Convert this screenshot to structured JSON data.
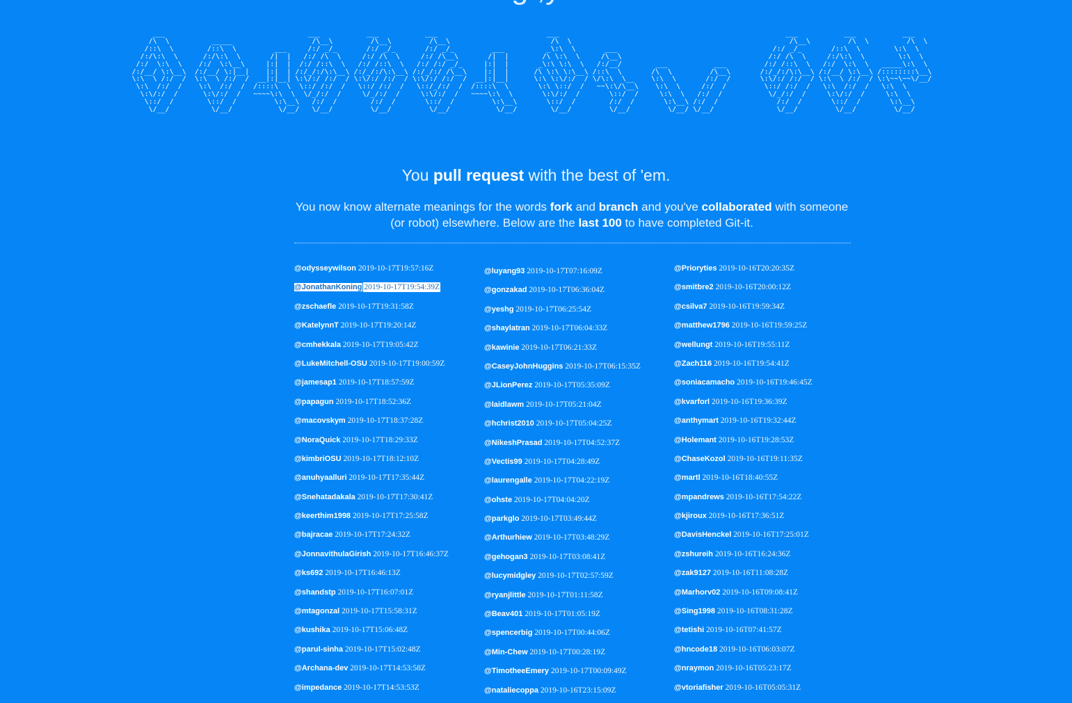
{
  "page": {
    "cut_heading": "g  ,y",
    "ascii_art": "      ___                                  ___           ___           ___                          ___                                                      ___           ___           ___     \n     /\\  \\          _____                   /\\__\\         /\\__\\         /\\__\\                        /\\  \\                                                    /\\__\\         /\\  \\         /\\  \\    \n    /::\\  \\        /::\\  \\         ___     /:/ _/_       /:/ _/_       /:/ _/_         ___          _\\:\\  \\       ___                                     /:/ _/_       /::\\  \\        \\:\\  \\   \n   /:/\\:\\  \\      /:/\\:\\  \\       /|  |   /:/ /\\  \\     /:/ /\\  \\     /:/ /\\__\\       /|  |        /\\ \\:\\  \\     /\\__\\                                   /:/ /\\  \\     /:/\\:\\  \\        \\:\\  \\  \n  /:/  \\:\\  \\    /:/  \\:\\__\\     |:|  |  /:/ /::\\  \\   /:/ /::\\  \\   /:/ /:/ _/_     |:|  |       _\\:\\ \\:\\  \\   /:/__/        ___           ___         /:/ /::\\  \\   /:/  \\:\\  \\   _____\\:\\  \\ \n /:/__/ \\:\\__\\  /:/__/ \\:|__|    |:|  | /:/_/:/\\:\\__\\ /:/_/:/\\:\\__\\ /:/_/:/ /\\__\\    |:|  |      /\\ \\:\\ \\:\\__\\ /::\\  \\       /\\  \\         /\\__\\       /:/_/:/\\:\\__\\ /:/__/ \\:\\__\\ /::::::::\\__\\\n \\:\\  \\ /:/  /  \\:\\  \\ /:/  /  __|:|__| \\:\\/:/ /:/  / \\:\\/:/ /:/  / \\:\\/:/ /:/  /  __|:|__|      \\:\\ \\:\\/:/  / \\/\\:\\  \\__    \\:\\  \\       /:/  /       \\:\\/:/ /:/  / \\:\\  \\ /:/  / \\:\\~~\\~~\\/__/\n  \\:\\  /:/  /    \\:\\  /:/  /  /::::\\  \\  \\::/ /:/  /   \\::/ /:/  /   \\::/_/:/  /  /::::\\  \\       \\:\\ \\::/  /   ~~\\:\\/\\__\\    \\:\\  \\     /:/  /         \\::/ /:/  /   \\:\\  /:/  /   \\:\\  \\      \n   \\:\\/:/  /      \\:\\/:/  /   ~~~~\\:\\  \\  \\/_/:/  /     \\/_/:/  /     \\:\\/:/  /   ~~~~\\:\\  \\       \\:\\/:/  /       \\::/  /     \\:\\  \\   /:/  /           \\/_/:/  /     \\:\\/:/  /     \\:\\  \\     \n    \\::/  /        \\::/  /         \\:\\__\\   /:/  /        /:/  /       \\::/  /         \\:\\__\\       \\::/  /        /:/  /       \\:\\__\\ /:/  /              /:/  /       \\::/  /       \\:\\__\\    \n     \\/__/          \\/__/           \\/__/   \\/__/         \\/__/         \\/__/           \\/__/        \\/__/         \\/__/         \\/__/ \\/__/               \\/__/         \\/__/         \\/__/    ",
    "tagline": {
      "pre": "You ",
      "bold": "pull request",
      "post": " with the best of 'em."
    },
    "intro": {
      "p1": "You now know alternate meanings for the words ",
      "b1": "fork",
      "p2": " and ",
      "b2": "branch",
      "p3": " and you've ",
      "b3": "collaborated",
      "p4": " with someone (or robot) elsewhere. Below are the ",
      "b4": "last 100",
      "p5": " to have completed Git-it."
    }
  },
  "completions": {
    "column1": [
      {
        "user": "@odysseywilson",
        "time": "2019-10-17T19:57:16Z"
      },
      {
        "user": "@JonathanKoning",
        "time": "2019-10-17T19:54:39Z"
      },
      {
        "user": "@zschaefle",
        "time": "2019-10-17T19:31:58Z"
      },
      {
        "user": "@KatelynnT",
        "time": "2019-10-17T19:20:14Z"
      },
      {
        "user": "@cmhekkala",
        "time": "2019-10-17T19:05:42Z"
      },
      {
        "user": "@LukeMitchell-OSU",
        "time": "2019-10-17T19:00:59Z"
      },
      {
        "user": "@jamesap1",
        "time": "2019-10-17T18:57:59Z"
      },
      {
        "user": "@papagun",
        "time": "2019-10-17T18:52:36Z"
      },
      {
        "user": "@macovskym",
        "time": "2019-10-17T18:37:28Z"
      },
      {
        "user": "@NoraQuick",
        "time": "2019-10-17T18:29:33Z"
      },
      {
        "user": "@kimbriOSU",
        "time": "2019-10-17T18:12:10Z"
      },
      {
        "user": "@anuhyaalluri",
        "time": "2019-10-17T17:35:44Z"
      },
      {
        "user": "@Snehatadakala",
        "time": "2019-10-17T17:30:41Z"
      },
      {
        "user": "@keerthim1998",
        "time": "2019-10-17T17:25:58Z"
      },
      {
        "user": "@bajracae",
        "time": "2019-10-17T17:24:32Z"
      },
      {
        "user": "@JonnavithulaGirish",
        "time": "2019-10-17T16:46:37Z"
      },
      {
        "user": "@ks692",
        "time": "2019-10-17T16:46:13Z"
      },
      {
        "user": "@shandstp",
        "time": "2019-10-17T16:07:01Z"
      },
      {
        "user": "@mtagonzal",
        "time": "2019-10-17T15:58:31Z"
      },
      {
        "user": "@kushika",
        "time": "2019-10-17T15:06:48Z"
      },
      {
        "user": "@parul-sinha",
        "time": "2019-10-17T15:02:48Z"
      },
      {
        "user": "@Archana-dev",
        "time": "2019-10-17T14:53:58Z"
      },
      {
        "user": "@impedance",
        "time": "2019-10-17T14:53:53Z"
      }
    ],
    "column2": [
      {
        "user": "@luyang93",
        "time": "2019-10-17T07:16:09Z"
      },
      {
        "user": "@gonzakad",
        "time": "2019-10-17T06:36:04Z"
      },
      {
        "user": "@yeshg",
        "time": "2019-10-17T06:25:54Z"
      },
      {
        "user": "@shaylatran",
        "time": "2019-10-17T06:04:33Z"
      },
      {
        "user": "@kawinie",
        "time": "2019-10-17T06:21:33Z"
      },
      {
        "user": "@CaseyJohnHuggins",
        "time": "2019-10-17T06:15:35Z"
      },
      {
        "user": "@JLionPerez",
        "time": "2019-10-17T05:35:09Z"
      },
      {
        "user": "@laidlawm",
        "time": "2019-10-17T05:21:04Z"
      },
      {
        "user": "@hchrist2010",
        "time": "2019-10-17T05:04:25Z"
      },
      {
        "user": "@NikeshPrasad",
        "time": "2019-10-17T04:52:37Z"
      },
      {
        "user": "@Vectis99",
        "time": "2019-10-17T04:28:49Z"
      },
      {
        "user": "@laurengalle",
        "time": "2019-10-17T04:22:19Z"
      },
      {
        "user": "@ohste",
        "time": "2019-10-17T04:04:20Z"
      },
      {
        "user": "@parkglo",
        "time": "2019-10-17T03:49:44Z"
      },
      {
        "user": "@Arthurhiew",
        "time": "2019-10-17T03:48:29Z"
      },
      {
        "user": "@gehogan3",
        "time": "2019-10-17T03:08:41Z"
      },
      {
        "user": "@lucymidgley",
        "time": "2019-10-17T02:57:59Z"
      },
      {
        "user": "@ryanjlittle",
        "time": "2019-10-17T01:11:58Z"
      },
      {
        "user": "@Beav401",
        "time": "2019-10-17T01:05:19Z"
      },
      {
        "user": "@spencerbig",
        "time": "2019-10-17T00:44:06Z"
      },
      {
        "user": "@Min-Chew",
        "time": "2019-10-17T00:28:19Z"
      },
      {
        "user": "@TimotheeEmery",
        "time": "2019-10-17T00:09:49Z"
      },
      {
        "user": "@nataliecoppa",
        "time": "2019-10-16T23:15:09Z"
      }
    ],
    "column3": [
      {
        "user": "@Prioryties",
        "time": "2019-10-16T20:20:35Z"
      },
      {
        "user": "@smitbre2",
        "time": "2019-10-16T20:00:12Z"
      },
      {
        "user": "@csilva7",
        "time": "2019-10-16T19:59:34Z"
      },
      {
        "user": "@matthew1796",
        "time": "2019-10-16T19:59:25Z"
      },
      {
        "user": "@wellungt",
        "time": "2019-10-16T19:55:11Z"
      },
      {
        "user": "@Zach116",
        "time": "2019-10-16T19:54:41Z"
      },
      {
        "user": "@soniacamacho",
        "time": "2019-10-16T19:46:45Z"
      },
      {
        "user": "@kvarforl",
        "time": "2019-10-16T19:36:39Z"
      },
      {
        "user": "@anthymart",
        "time": "2019-10-16T19:32:44Z"
      },
      {
        "user": "@Holemant",
        "time": "2019-10-16T19:28:53Z"
      },
      {
        "user": "@ChaseKozol",
        "time": "2019-10-16T19:11:35Z"
      },
      {
        "user": "@martl",
        "time": "2019-10-16T18:40:55Z"
      },
      {
        "user": "@mpandrews",
        "time": "2019-10-16T17:54:22Z"
      },
      {
        "user": "@kjiroux",
        "time": "2019-10-16T17:36:51Z"
      },
      {
        "user": "@DavisHenckel",
        "time": "2019-10-16T17:25:01Z"
      },
      {
        "user": "@zshureih",
        "time": "2019-10-16T16:24:36Z"
      },
      {
        "user": "@zak9127",
        "time": "2019-10-16T11:08:28Z"
      },
      {
        "user": "@Marhorv02",
        "time": "2019-10-16T09:08:41Z"
      },
      {
        "user": "@Sing1998",
        "time": "2019-10-16T08:31:28Z"
      },
      {
        "user": "@tetishi",
        "time": "2019-10-16T07:41:57Z"
      },
      {
        "user": "@hncode18",
        "time": "2019-10-16T06:03:07Z"
      },
      {
        "user": "@nraymon",
        "time": "2019-10-16T05:23:17Z"
      },
      {
        "user": "@vtoriafisher",
        "time": "2019-10-16T05:05:31Z"
      }
    ]
  }
}
